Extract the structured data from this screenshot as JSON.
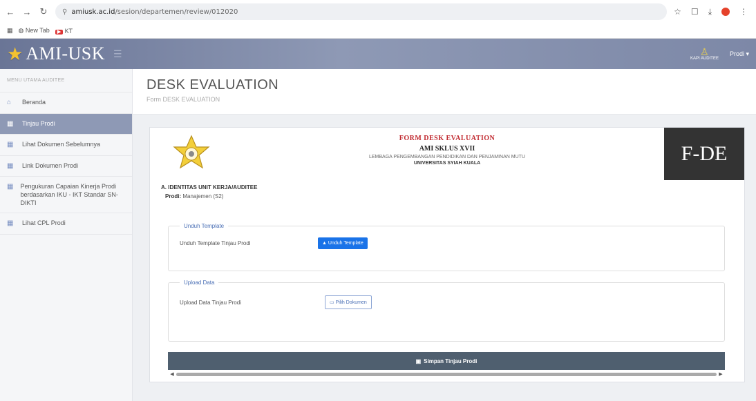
{
  "browser": {
    "url_host": "amiusk.ac.id",
    "url_path": "/sesion/departemen/review/012020",
    "bookmarks": [
      "New Tab",
      "KT"
    ]
  },
  "header": {
    "app_title": "AMI-USK",
    "avatar_caption": "KAPI AUDITEE",
    "user_label": "Prodi"
  },
  "sidebar": {
    "header": "MENU UTAMA AUDITEE",
    "items": [
      {
        "label": "Beranda",
        "icon": "home-icon"
      },
      {
        "label": "Tinjau Prodi",
        "icon": "calendar-icon"
      },
      {
        "label": "Lihat Dokumen Sebelumnya",
        "icon": "calendar-icon"
      },
      {
        "label": "Link Dokumen Prodi",
        "icon": "calendar-icon"
      },
      {
        "label": "Pengukuran Capaian Kinerja Prodi berdasarkan IKU - IKT Standar SN-DIKTI",
        "icon": "calendar-icon"
      },
      {
        "label": "Lihat CPL Prodi",
        "icon": "calendar-icon"
      }
    ]
  },
  "page": {
    "title": "DESK EVALUATION",
    "subtitle": "Form DESK EVALUATION"
  },
  "form": {
    "banner_title": "FORM DESK EVALUATION",
    "banner_cycle": "AMI SKLUS XVII",
    "banner_institution": "LEMBAGA PENGEMBANGAN PENDIDIKAN DAN PENJAMINAN MUTU",
    "banner_university": "UNIVERSITAS SYIAH KUALA",
    "code": "F-DE",
    "identity_title": "A. IDENTITAS UNIT KERJA/AUDITEE",
    "prodi_label": "Prodi:",
    "prodi_value": "Manajemen (S2)",
    "download_legend": "Unduh Template",
    "download_row_label": "Unduh Template Tinjau Prodi",
    "download_button": "Unduh Template",
    "upload_legend": "Upload Data",
    "upload_row_label": "Upload Data Tinjau Prodi",
    "upload_button": "Pilih Dokumen",
    "save_button": "Simpan Tinjau Prodi"
  },
  "colors": {
    "header_bg": "#7d88a7",
    "active_item": "#8e99b5",
    "primary": "#1a73e8",
    "save_bar": "#4f5f6f",
    "banner_red": "#c0272d"
  }
}
